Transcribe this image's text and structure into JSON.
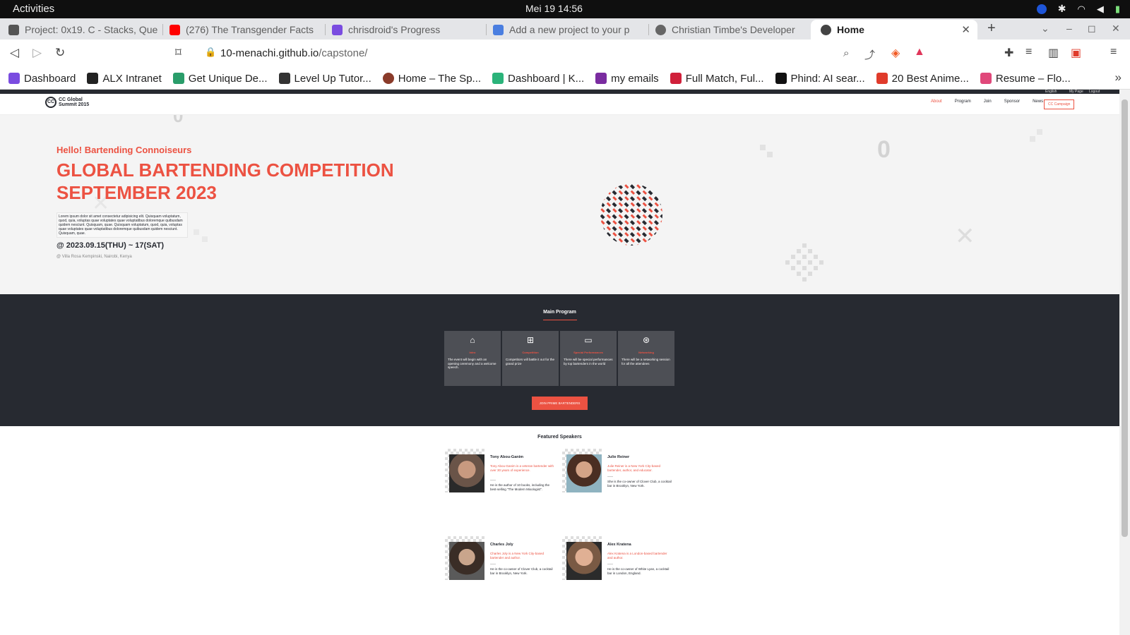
{
  "os": {
    "activities": "Activities",
    "clock": "Mei 19  14:56"
  },
  "tabs": [
    {
      "label": "Project: 0x19. C - Stacks, Que",
      "color": "#555555"
    },
    {
      "label": "(276) The Transgender Facts",
      "color": "#ff0000"
    },
    {
      "label": "chrisdroid's Progress",
      "color": "#7a4ce0"
    },
    {
      "label": "Add a new project to your p",
      "color": "#4a7ee0"
    },
    {
      "label": "Christian Timbe's Developer",
      "color": "#666666"
    },
    {
      "label": "Home",
      "color": "#444444"
    }
  ],
  "address": {
    "host": "10-menachi.github.io",
    "path": "/capstone/"
  },
  "bookmarks": [
    {
      "label": "Dashboard",
      "color": "#7a4ce0"
    },
    {
      "label": "ALX Intranet",
      "color": "#222222"
    },
    {
      "label": "Get Unique De...",
      "color": "#2a9d6a"
    },
    {
      "label": "Level Up Tutor...",
      "color": "#333333"
    },
    {
      "label": "Home – The Sp...",
      "color": "#8a3b2a"
    },
    {
      "label": "Dashboard | K...",
      "color": "#2bb37a"
    },
    {
      "label": "my emails",
      "color": "#7a2ca0"
    },
    {
      "label": "Full Match, Ful...",
      "color": "#d0203a"
    },
    {
      "label": "Phind: AI sear...",
      "color": "#111111"
    },
    {
      "label": "20 Best Anime...",
      "color": "#e03b2b"
    },
    {
      "label": "Resume – Flo...",
      "color": "#e0487a"
    }
  ],
  "site": {
    "top_links": [
      "English",
      "My Page",
      "Logout"
    ],
    "logo": {
      "mark": "CC",
      "line1": "CC Global",
      "line2": "Summit 2015"
    },
    "nav": [
      "About",
      "Program",
      "Join",
      "Sponsor",
      "News"
    ],
    "nav_cta": "CC Campaign",
    "hero": {
      "greeting": "Hello! Bartending Connoiseurs",
      "title": "GLOBAL BARTENDING COMPETITION SEPTEMBER 2023",
      "description": "Lorem ipsum dolor sit amet consectetur adipisicing elit. Quisquam voluptatum, quod, quia, voluptas quae voluptates quae voluptatibus doloremque quibusdam quidem nesciunt. Quisquam, quae. Quisquam voluptatum, quod, quia, voluptas quae voluptates quae voluptatibus doloremque quibusdam quidem nesciunt. Quisquam, quae.",
      "date": "@ 2023.09.15(THU) ~ 17(SAT)",
      "venue": "@ Villa Rosa Kempinski, Nairobi, Kenya"
    },
    "program": {
      "title": "Main Program",
      "cards": [
        {
          "icon": "intro-icon",
          "glyph": "⌂",
          "title": "Intro",
          "desc": "The event will begin with an opening ceremony and a welcome speech."
        },
        {
          "icon": "competition-icon",
          "glyph": "⊞",
          "title": "Competition",
          "desc": "Competitors will battle it out for the grand prize"
        },
        {
          "icon": "performance-icon",
          "glyph": "▭",
          "title": "Special Performances",
          "desc": "There will be special performances by top bartenders in the world"
        },
        {
          "icon": "networking-icon",
          "glyph": "⊛",
          "title": "Networking",
          "desc": "There will be a networking session for all the attendees"
        }
      ],
      "cta": "JOIN PRIME BARTENDERS"
    },
    "speakers": {
      "title": "Featured Speakers",
      "items": [
        {
          "name": "Tony Abou-Ganim",
          "role": "Tony Abou-Ganim is a veteran bartender with over 30 years of experience.",
          "bio": "He is the author of 10 books, including the best-selling \"The Modern Mixologist\"."
        },
        {
          "name": "Julie Reiner",
          "role": "Julie Reiner is a New York City-based bartender, author, and educator.",
          "bio": "She is the co-owner of Clover Club, a cocktail bar in Brooklyn, New York."
        },
        {
          "name": "Charles Joly",
          "role": "Charles Joly is a New York City-based bartender and author.",
          "bio": "He is the co-owner of Clover Club, a cocktail bar in Brooklyn, New York."
        },
        {
          "name": "Alex Kratena",
          "role": "Alex Kratena is a London-based bartender and author.",
          "bio": "He is the co-owner of White Lyan, a cocktail bar in London, England."
        }
      ]
    }
  },
  "colors": {
    "accent": "#ec5242",
    "dark": "#272a31",
    "hero_bg": "#f4f4f4"
  }
}
